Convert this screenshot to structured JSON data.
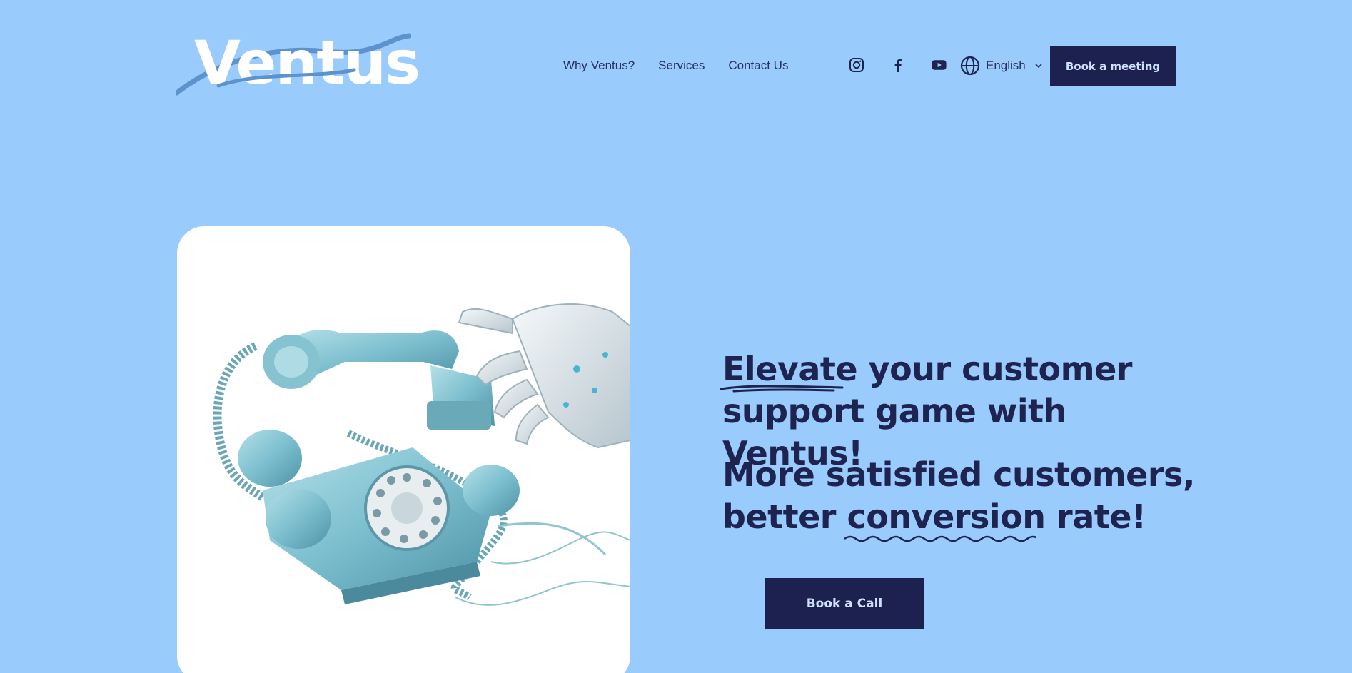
{
  "brand": {
    "logo_text": "Ventus"
  },
  "nav": {
    "items": [
      "Why Ventus?",
      "Services",
      "Contact Us"
    ]
  },
  "social": [
    "instagram-icon",
    "facebook-icon",
    "youtube-icon"
  ],
  "language": {
    "selected": "English"
  },
  "header": {
    "cta_label": "Book a meeting"
  },
  "hero": {
    "headline_part1_highlight": "Elevate",
    "headline_part1_rest": " your customer support game with Ventus!",
    "headline_part2_start": "More satisfied customers, better ",
    "headline_part2_highlight": "conversion",
    "headline_part2_end": " rate!",
    "cta_label": "Book a Call"
  },
  "colors": {
    "background": "#99cbfd",
    "navy": "#1d2150",
    "button_text": "#cfe2ff"
  }
}
